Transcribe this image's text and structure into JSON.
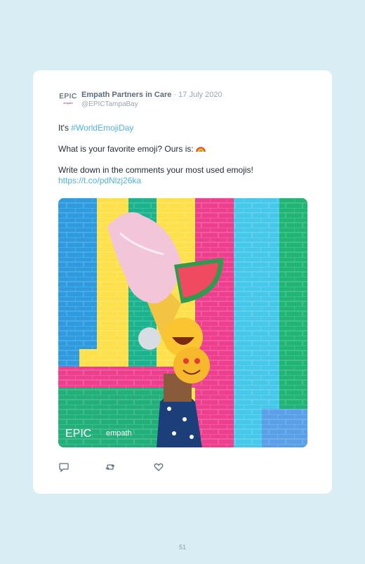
{
  "post": {
    "avatar": {
      "logo_text": "EPIC",
      "logo_sub": "empath"
    },
    "author_name": "Empath Partners in Care",
    "separator": "·",
    "date": "17 July 2020",
    "handle": "@EPICTampaBay",
    "line1_prefix": "It's ",
    "line1_hashtag": "#WorldEmojiDay",
    "line2": "What is your favorite emoji? Ours is:",
    "line2_emoji": "🌈",
    "line3": "Write down in the comments your most used emojis!",
    "link": "https://t.co/pdNlzj26ka",
    "image": {
      "description_icon": "photo",
      "watermark_left": "EPIC",
      "watermark_right": "empath"
    },
    "actions": {
      "reply_icon": "comment-icon",
      "retweet_icon": "retweet-icon",
      "like_icon": "heart-icon"
    }
  },
  "page_number": "51",
  "colors": {
    "background": "#d9eef4",
    "card": "#ffffff",
    "link": "#4fb3e0",
    "muted": "#9aa6b2"
  }
}
